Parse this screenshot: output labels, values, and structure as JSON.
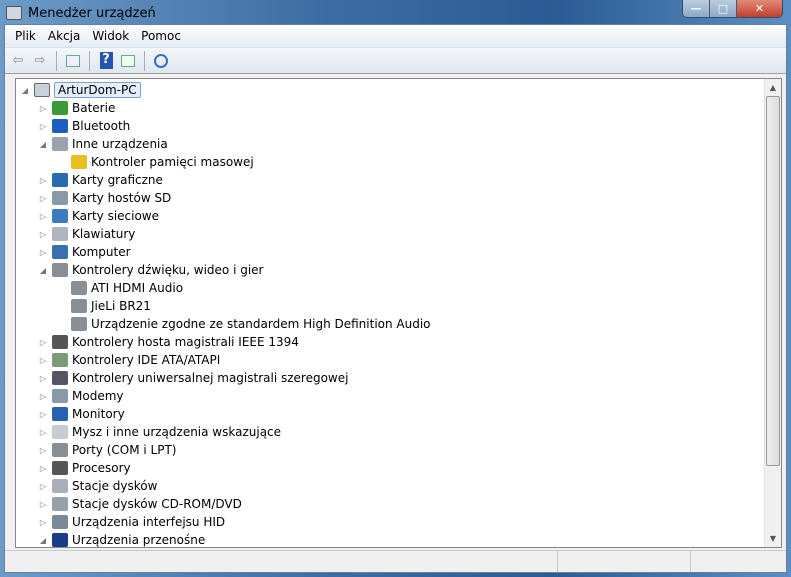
{
  "window": {
    "title": "Menedżer urządzeń",
    "minimize": "—",
    "maximize": "□",
    "close": "✕"
  },
  "menu": [
    "Plik",
    "Akcja",
    "Widok",
    "Pomoc"
  ],
  "toolbar": {
    "back": "⇦",
    "forward": "⇨",
    "help": "?"
  },
  "tree": {
    "root": "ArturDom-PC",
    "items": [
      {
        "label": "Baterie",
        "level": 1,
        "exp": "▷",
        "color": "#3a9a3a"
      },
      {
        "label": "Bluetooth",
        "level": 1,
        "exp": "▷",
        "color": "#1c5fbf"
      },
      {
        "label": "Inne urządzenia",
        "level": 1,
        "exp": "◢",
        "color": "#9aa4b0"
      },
      {
        "label": "Kontroler pamięci masowej",
        "level": 2,
        "exp": "",
        "color": "#e8c020"
      },
      {
        "label": "Karty graficzne",
        "level": 1,
        "exp": "▷",
        "color": "#2a6ab0"
      },
      {
        "label": "Karty hostów SD",
        "level": 1,
        "exp": "▷",
        "color": "#8899aa"
      },
      {
        "label": "Karty sieciowe",
        "level": 1,
        "exp": "▷",
        "color": "#3a7ac0"
      },
      {
        "label": "Klawiatury",
        "level": 1,
        "exp": "▷",
        "color": "#b0b6be"
      },
      {
        "label": "Komputer",
        "level": 1,
        "exp": "▷",
        "color": "#3a70b0"
      },
      {
        "label": "Kontrolery dźwięku, wideo i gier",
        "level": 1,
        "exp": "◢",
        "color": "#8a8f96"
      },
      {
        "label": "ATI HDMI Audio",
        "level": 2,
        "exp": "",
        "color": "#8a8f96"
      },
      {
        "label": "JieLi BR21",
        "level": 2,
        "exp": "",
        "color": "#8a8f96"
      },
      {
        "label": "Urządzenie zgodne ze standardem High Definition Audio",
        "level": 2,
        "exp": "",
        "color": "#8a8f96"
      },
      {
        "label": "Kontrolery hosta magistrali IEEE 1394",
        "level": 1,
        "exp": "▷",
        "color": "#555"
      },
      {
        "label": "Kontrolery IDE ATA/ATAPI",
        "level": 1,
        "exp": "▷",
        "color": "#7a9a7a"
      },
      {
        "label": "Kontrolery uniwersalnej magistrali szeregowej",
        "level": 1,
        "exp": "▷",
        "color": "#556"
      },
      {
        "label": "Modemy",
        "level": 1,
        "exp": "▷",
        "color": "#8899aa"
      },
      {
        "label": "Monitory",
        "level": 1,
        "exp": "▷",
        "color": "#2a60b0"
      },
      {
        "label": "Mysz i inne urządzenia wskazujące",
        "level": 1,
        "exp": "▷",
        "color": "#c8ccd2"
      },
      {
        "label": "Porty (COM i LPT)",
        "level": 1,
        "exp": "▷",
        "color": "#8a8f96"
      },
      {
        "label": "Procesory",
        "level": 1,
        "exp": "▷",
        "color": "#555"
      },
      {
        "label": "Stacje dysków",
        "level": 1,
        "exp": "▷",
        "color": "#aab0b8"
      },
      {
        "label": "Stacje dysków CD-ROM/DVD",
        "level": 1,
        "exp": "▷",
        "color": "#9aa0a8"
      },
      {
        "label": "Urządzenia interfejsu HID",
        "level": 1,
        "exp": "▷",
        "color": "#7a8a9a"
      },
      {
        "label": "Urządzenia przenośne",
        "level": 1,
        "exp": "◢",
        "color": "#1a3a8a"
      }
    ]
  }
}
